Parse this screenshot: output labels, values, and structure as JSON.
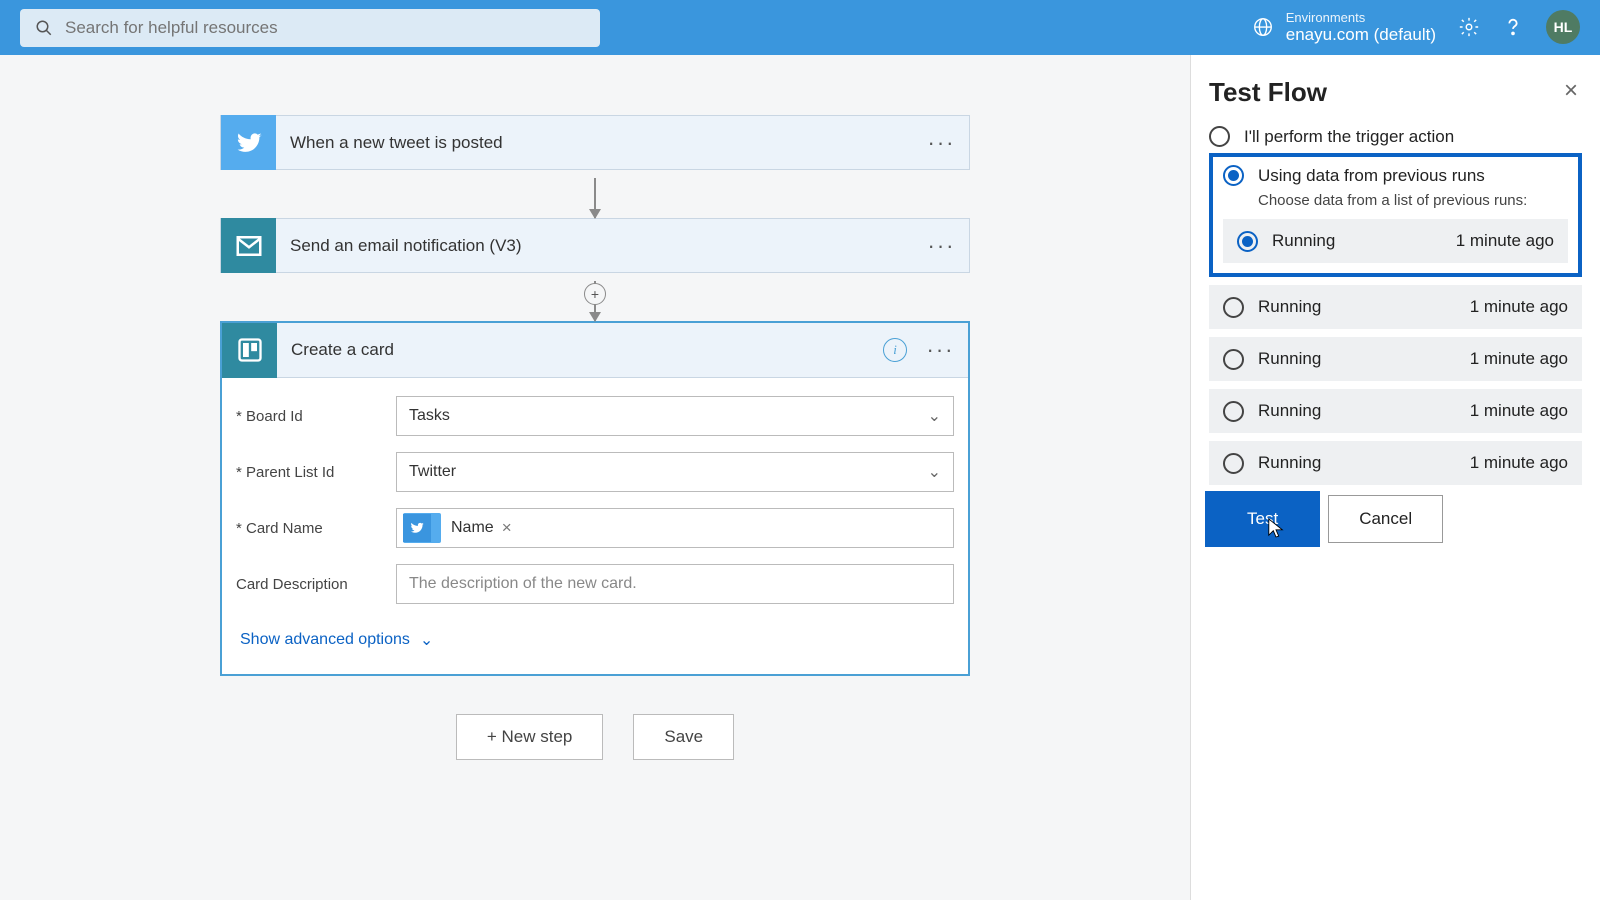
{
  "header": {
    "search_placeholder": "Search for helpful resources",
    "env_label": "Environments",
    "env_value": "enayu.com (default)",
    "avatar": "HL"
  },
  "flow": {
    "step1": {
      "title": "When a new tweet is posted"
    },
    "step2": {
      "title": "Send an email notification (V3)"
    },
    "step3": {
      "title": "Create a card",
      "fields": {
        "board_label": "* Board Id",
        "board_value": "Tasks",
        "list_label": "* Parent List Id",
        "list_value": "Twitter",
        "cardname_label": "* Card Name",
        "cardname_token": "Name",
        "desc_label": "Card Description",
        "desc_placeholder": "The description of the new card."
      },
      "advanced": "Show advanced options"
    },
    "buttons": {
      "new_step": "+ New step",
      "save": "Save"
    }
  },
  "panel": {
    "title": "Test Flow",
    "opt1": "I'll perform the trigger action",
    "opt2": "Using data from previous runs",
    "opt2_sub": "Choose data from a list of previous runs:",
    "runs": [
      {
        "status": "Running",
        "time": "1 minute ago"
      },
      {
        "status": "Running",
        "time": "1 minute ago"
      },
      {
        "status": "Running",
        "time": "1 minute ago"
      },
      {
        "status": "Running",
        "time": "1 minute ago"
      },
      {
        "status": "Running",
        "time": "1 minute ago"
      }
    ],
    "test_btn": "Test",
    "cancel_btn": "Cancel"
  }
}
